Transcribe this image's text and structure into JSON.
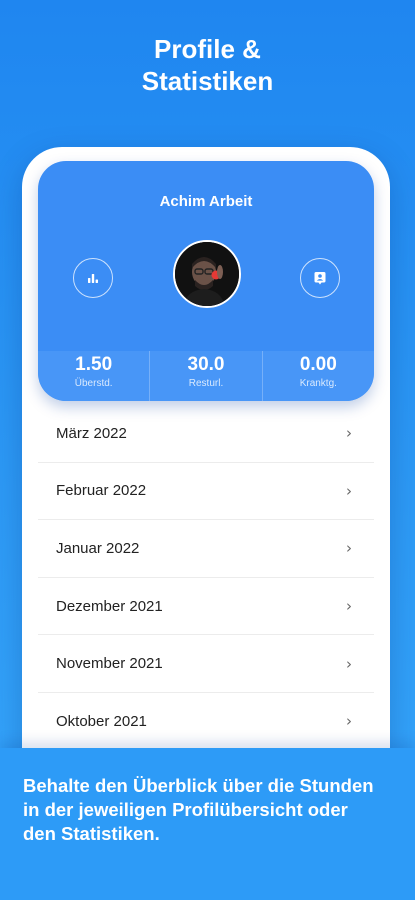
{
  "headline": {
    "line1": "Profile &",
    "line2": "Statistiken"
  },
  "profile": {
    "name": "Achim Arbeit",
    "left_icon": "bar-chart-icon",
    "right_icon": "contact-card-icon"
  },
  "stats": [
    {
      "value": "1.50",
      "label": "Überstd."
    },
    {
      "value": "30.0",
      "label": "Resturl."
    },
    {
      "value": "0.00",
      "label": "Kranktg."
    }
  ],
  "months": [
    {
      "label": "März 2022"
    },
    {
      "label": "Februar 2022"
    },
    {
      "label": "Januar 2022"
    },
    {
      "label": "Dezember 2021"
    },
    {
      "label": "November 2021"
    },
    {
      "label": "Oktober 2021"
    }
  ],
  "chevron": "›",
  "caption": "Behalte den Überblick über die Stunden in der jeweiligen Profilübersicht oder den Statistiken.",
  "colors": {
    "brand_blue": "#2d9bf7",
    "card_blue": "#3b8df5",
    "accent_red": "#e53935"
  }
}
